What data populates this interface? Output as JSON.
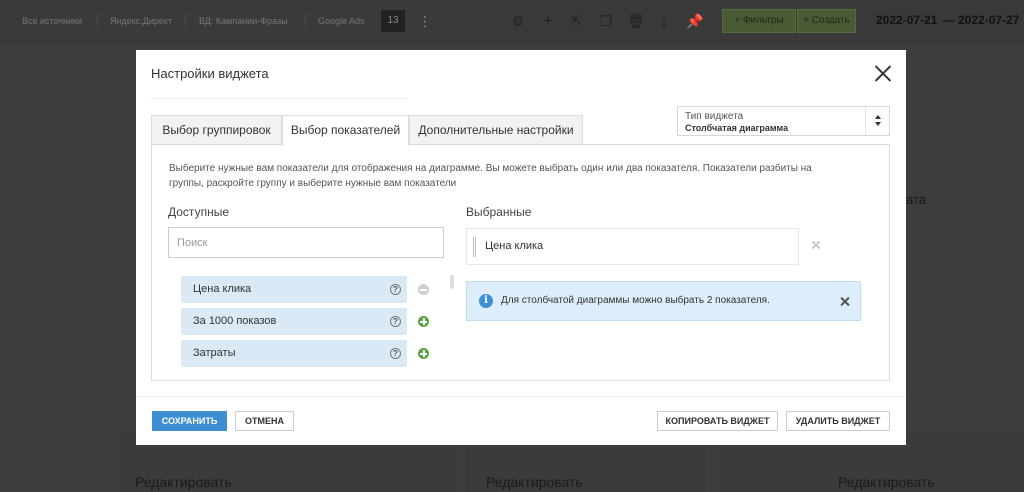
{
  "app": {
    "tabs": [
      "Все источники",
      "Яндекс.Директ",
      "ВД: Кампании-Фразы",
      "Google Ads"
    ],
    "count_badge": "13",
    "filters_label": "+ Фильтры",
    "create_label": "+ Создать",
    "date_from": "2022-07-21",
    "date_sep": "—",
    "date_to": "2022-07-27",
    "bg_edit_label": "Редактировать",
    "bg_side_text": "ата"
  },
  "modal": {
    "title": "Настройки виджета",
    "widget_type_label": "Тип виджета",
    "widget_type_value": "Столбчатая диаграмма",
    "tabs": [
      {
        "label": "Выбор группировок"
      },
      {
        "label": "Выбор показателей"
      },
      {
        "label": "Дополнительные настройки"
      }
    ],
    "active_tab": "Выбор показателей",
    "intro": "Выберите нужные вам показатели для отображения на диаграмме. Вы можете выбрать один или два показателя. Показатели разбиты на группы, раскройте группу и выберите нужные вам показатели",
    "available_label": "Доступные",
    "selected_label": "Выбранные",
    "search_placeholder": "Поиск",
    "search_value": "",
    "available_metrics": [
      {
        "name": "Цена клика",
        "help": "?",
        "added": true
      },
      {
        "name": "За 1000 показов",
        "help": "?",
        "added": false
      },
      {
        "name": "Затраты",
        "help": "?",
        "added": false
      }
    ],
    "selected_metrics": [
      {
        "name": "Цена клика"
      }
    ],
    "alert_icon": "i",
    "alert_text": "Для столбчатой диаграммы можно выбрать 2 показателя.",
    "buttons": {
      "save": "Сохранить",
      "cancel": "Отмена",
      "copy": "Копировать виджет",
      "delete": "Удалить виджет"
    }
  },
  "colors": {
    "primary_button": "#3e8ed4",
    "metric_bg": "#d9e9f5",
    "add_icon": "#5aa644",
    "alert_bg": "#dceefa",
    "overlay": "#3d3d3d"
  },
  "icons": [
    "settings-icon",
    "plus-icon",
    "export-icon",
    "copy-icon",
    "trash-icon",
    "download-icon",
    "pin-icon",
    "close-icon",
    "select-arrows-icon",
    "help-icon",
    "add-icon",
    "remove-icon",
    "info-icon",
    "drag-handle-icon"
  ]
}
